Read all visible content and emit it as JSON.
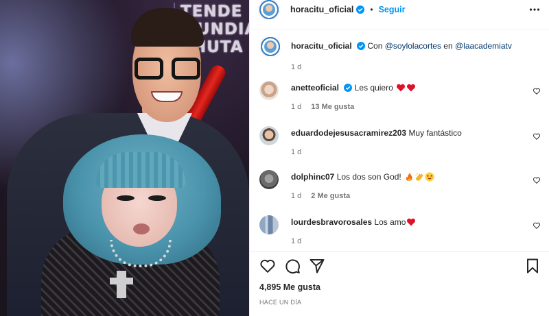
{
  "photo": {
    "stage_text": [
      "TENDE",
      "MUNDIA",
      "CHUTA"
    ]
  },
  "post": {
    "username": "horacitu_oficial",
    "follow_label": "Seguir",
    "separator": "•",
    "caption_prefix": "Con ",
    "caption_mention_1": "@soylolacortes",
    "caption_middle": " en ",
    "caption_mention_2": "@laacademiatv",
    "caption_time": "1 d",
    "likes": "4,895 Me gusta",
    "posted_ago": "HACE UN DÍA"
  },
  "comments": [
    {
      "user": "anetteoficial",
      "verified": true,
      "text": "Les quiero ",
      "emojis": [
        "red-heart",
        "red-heart"
      ],
      "time": "1 d",
      "likes": "13 Me gusta"
    },
    {
      "user": "eduardodejesusacramirez203",
      "verified": false,
      "text": "Muy fantástico",
      "emojis": [],
      "time": "1 d",
      "likes": ""
    },
    {
      "user": "dolphinc07",
      "verified": false,
      "text": "Los dos son God! ",
      "emojis": [
        "fire",
        "clap",
        "star-struck"
      ],
      "time": "1 d",
      "likes": "2 Me gusta"
    },
    {
      "user": "lourdesbravorosales",
      "verified": false,
      "text": "Los amo",
      "emojis": [
        "red-heart"
      ],
      "time": "1 d",
      "likes": ""
    }
  ],
  "icons": {
    "verified": "verified-badge-icon",
    "more": "more-options-icon",
    "like": "heart-icon",
    "comment": "comment-icon",
    "share": "share-icon",
    "save": "bookmark-icon"
  },
  "colors": {
    "accent": "#0095f6",
    "verified": "#0095f6",
    "mention": "#00376b",
    "muted": "#737373",
    "heart_red": "#e0112a"
  }
}
